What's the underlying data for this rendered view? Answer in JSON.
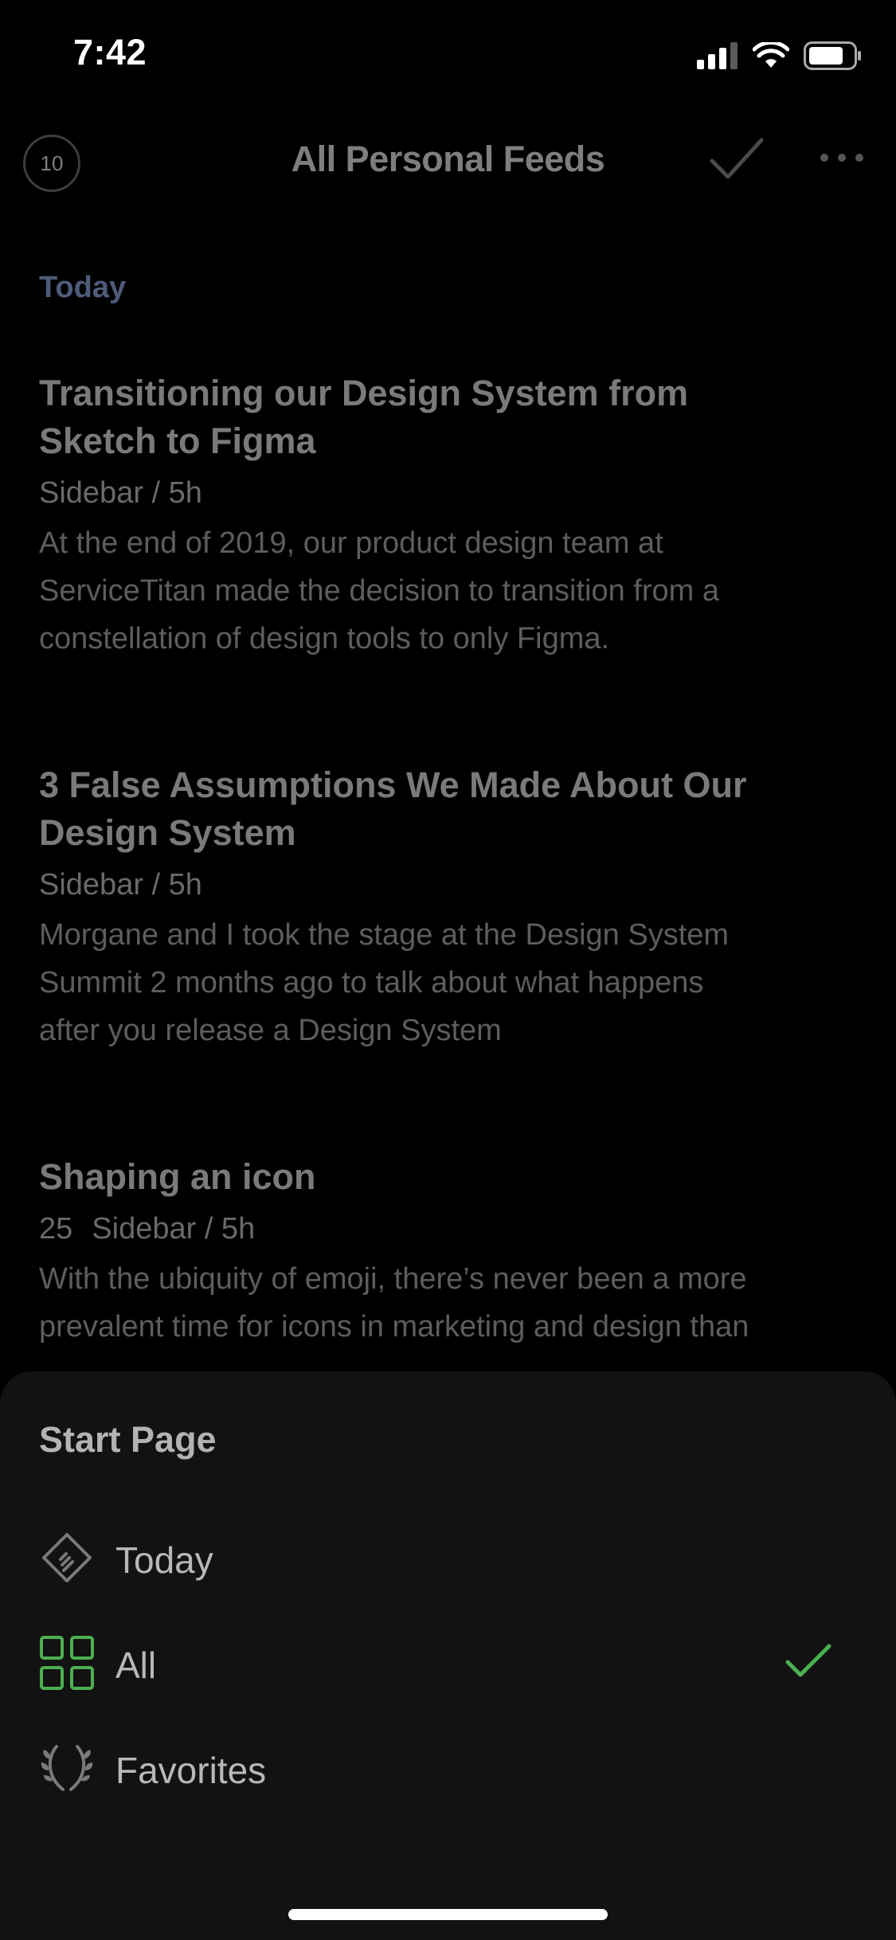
{
  "status_bar": {
    "time": "7:42"
  },
  "nav": {
    "unread_count": "10",
    "title": "All Personal Feeds"
  },
  "feed": {
    "section_label": "Today",
    "articles": [
      {
        "title_line1": "Transitioning our Design System from",
        "title_line2": "Sketch to Figma",
        "likes": "",
        "meta": "Sidebar / 5h",
        "summary_line1": "At the end of 2019, our product design team at",
        "summary_line2": "ServiceTitan made the decision to transition from a",
        "summary_line3": "constellation of design tools to only Figma."
      },
      {
        "title_line1": "3 False Assumptions We Made About Our",
        "title_line2": "Design System",
        "likes": "",
        "meta": "Sidebar / 5h",
        "summary_line1": "Morgane and I took the stage at the Design System",
        "summary_line2": "Summit 2 months ago to talk about what happens",
        "summary_line3": "after you release a Design System"
      },
      {
        "title_line1": "Shaping an icon",
        "title_line2": "",
        "likes": "25",
        "meta": "Sidebar / 5h",
        "summary_line1": "With the ubiquity of emoji, there’s never been a more",
        "summary_line2": "prevalent time for icons in marketing and design than",
        "summary_line3": ""
      }
    ]
  },
  "sheet": {
    "title": "Start Page",
    "options": [
      {
        "label": "Today",
        "icon": "feedly-today-icon",
        "selected": false
      },
      {
        "label": "All",
        "icon": "grid-icon",
        "selected": true
      },
      {
        "label": "Favorites",
        "icon": "laurel-icon",
        "selected": false
      }
    ]
  },
  "colors": {
    "accent_green": "#4caf50",
    "section_blue": "#4e5b79"
  }
}
